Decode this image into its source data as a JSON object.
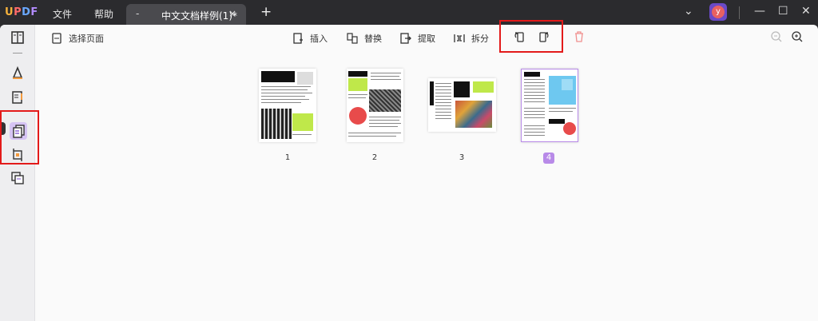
{
  "app": {
    "logo": "UPDF",
    "menu": [
      "文件",
      "帮助"
    ],
    "tab_title": "中文文档样例(1)*",
    "tab_close": "×",
    "tab_dash": "-",
    "new_tab": "+",
    "user_initial": "y"
  },
  "toolbar": {
    "select_pages": "选择页面",
    "insert": "插入",
    "replace": "替换",
    "extract": "提取",
    "split": "拆分"
  },
  "pages": [
    {
      "number": "1",
      "selected": false
    },
    {
      "number": "2",
      "selected": false
    },
    {
      "number": "3",
      "selected": false
    },
    {
      "number": "4",
      "selected": true
    }
  ],
  "colors": {
    "accent": "#b88ae8",
    "highlight_box": "#e31a1a",
    "lime": "#bfe84a",
    "red_circle": "#e84b4b"
  }
}
